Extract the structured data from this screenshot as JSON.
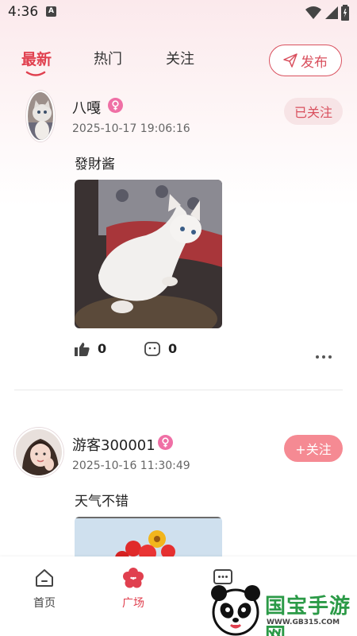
{
  "status_bar": {
    "time": "4:36",
    "app_icon_letter": "A"
  },
  "tabs": [
    {
      "label": "最新",
      "active": true
    },
    {
      "label": "热门",
      "active": false
    },
    {
      "label": "关注",
      "active": false
    }
  ],
  "publish_button": {
    "label": "发布",
    "icon": "send-icon"
  },
  "posts": [
    {
      "username": "八嘎",
      "gender": "female",
      "timestamp": "2025-10-17 19:06:16",
      "follow_label": "已关注",
      "text": "發財酱",
      "likes": "0",
      "comments": "0"
    },
    {
      "username": "游客300001",
      "gender": "female",
      "timestamp": "2025-10-16 11:30:49",
      "follow_label": "+关注",
      "text": "天气不错"
    }
  ],
  "bottom_nav": [
    {
      "label": "首页",
      "icon": "home-icon",
      "active": false
    },
    {
      "label": "广场",
      "icon": "flower-icon",
      "active": true
    },
    {
      "label": "",
      "icon": "message-icon",
      "active": false
    }
  ],
  "watermark": {
    "text": "国宝手游网",
    "url": "WWW.GB315.COM"
  },
  "colors": {
    "accent": "#e0404f",
    "follow_bg": "#f58a93",
    "followed_bg": "#f7e4e6",
    "badge": "#ef6fa5"
  }
}
